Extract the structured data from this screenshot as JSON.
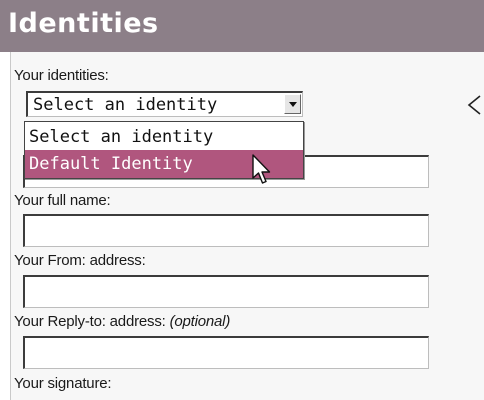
{
  "header": {
    "title": "Identities",
    "color": "#8c7f88"
  },
  "identities": {
    "label": "Your identities:",
    "select": {
      "selected": "Select an identity",
      "options": [
        "Select an identity",
        "Default Identity"
      ],
      "highlighted": "Default Identity",
      "highlight_color": "#b0567e"
    }
  },
  "fields": {
    "full_name_label": "Your full name:",
    "from_label": "Your From: address:",
    "reply_label": "Your Reply-to: address:",
    "reply_optional": "(optional)",
    "signature_label": "Your signature:"
  },
  "icons": {
    "dropdown": "chevron-down-icon",
    "cursor": "mouse-pointer-icon",
    "edge": "chevron-left-icon"
  }
}
